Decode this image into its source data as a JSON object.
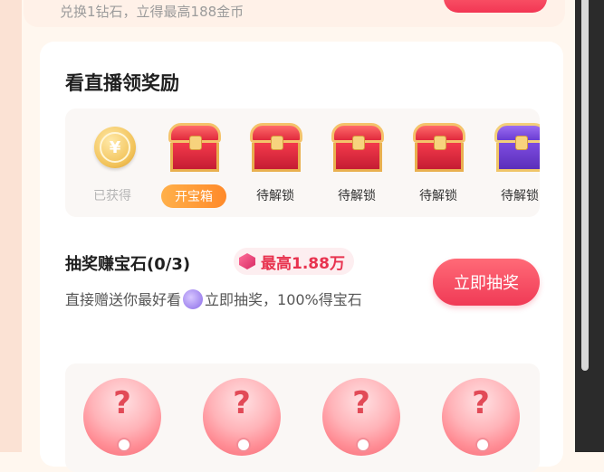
{
  "top": {
    "subtitle": "兑换1钻石，立得最高188金币"
  },
  "watch_reward": {
    "title": "看直播领奖励",
    "coin_symbol": "¥",
    "items": [
      {
        "label": "已获得",
        "type": "coin"
      },
      {
        "label": "开宝箱",
        "type": "chest-red",
        "action": true
      },
      {
        "label": "待解锁",
        "type": "chest-red"
      },
      {
        "label": "待解锁",
        "type": "chest-red"
      },
      {
        "label": "待解锁",
        "type": "chest-red"
      },
      {
        "label": "待解锁",
        "type": "chest-purple"
      }
    ]
  },
  "lottery": {
    "title": "抽奖赚宝石(0/3)",
    "max_label": "最高1.88万",
    "desc_part1": "直接赠送你最好看",
    "desc_part2": "立即抽奖，100%得宝石",
    "button_label": "立即抽奖",
    "ball_symbol": "?"
  },
  "colors": {
    "accent": "#f03a56",
    "orange": "#ff8a2a"
  }
}
